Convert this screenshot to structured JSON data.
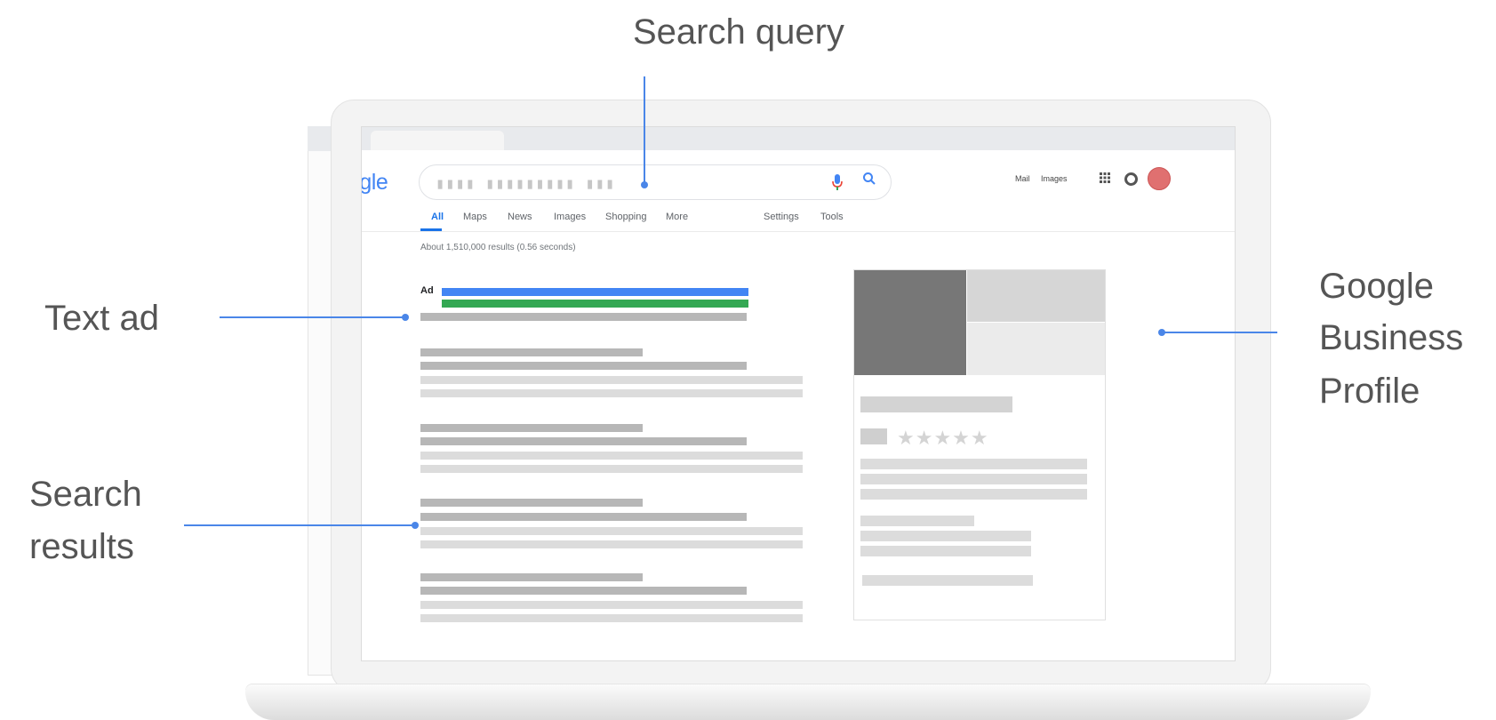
{
  "callouts": {
    "search_query": "Search query",
    "text_ad": "Text ad",
    "gbp_line1": "Google",
    "gbp_line2": "Business",
    "gbp_line3": "Profile",
    "results_line1": "Search",
    "results_line2": "results"
  },
  "browser": {
    "logo_text": "ogle",
    "query_masked": "▮▮▮▮ ▮▮▮▮▮▮▮▮▮ ▮▮▮",
    "top_links": {
      "mail": "Mail",
      "images": "Images"
    },
    "tabs": [
      {
        "label": "All",
        "active": true
      },
      {
        "label": "Maps"
      },
      {
        "label": "News"
      },
      {
        "label": "Images"
      },
      {
        "label": "Shopping"
      },
      {
        "label": "More"
      },
      {
        "label": "Settings"
      },
      {
        "label": "Tools"
      }
    ],
    "result_stats": "About 1,510,000 results (0.56 seconds)",
    "ad_label": "Ad",
    "stars": "★★★★★"
  },
  "colors": {
    "accent_line": "#4a86e8",
    "ad_blue": "#4285f4",
    "ad_green": "#34a853",
    "placeholder_dark": "#b7b7b7",
    "placeholder_light": "#dcdcdc"
  },
  "icons": [
    "mic-icon",
    "search-icon",
    "apps-grid-icon",
    "notifications-icon",
    "avatar",
    "star-icon"
  ]
}
